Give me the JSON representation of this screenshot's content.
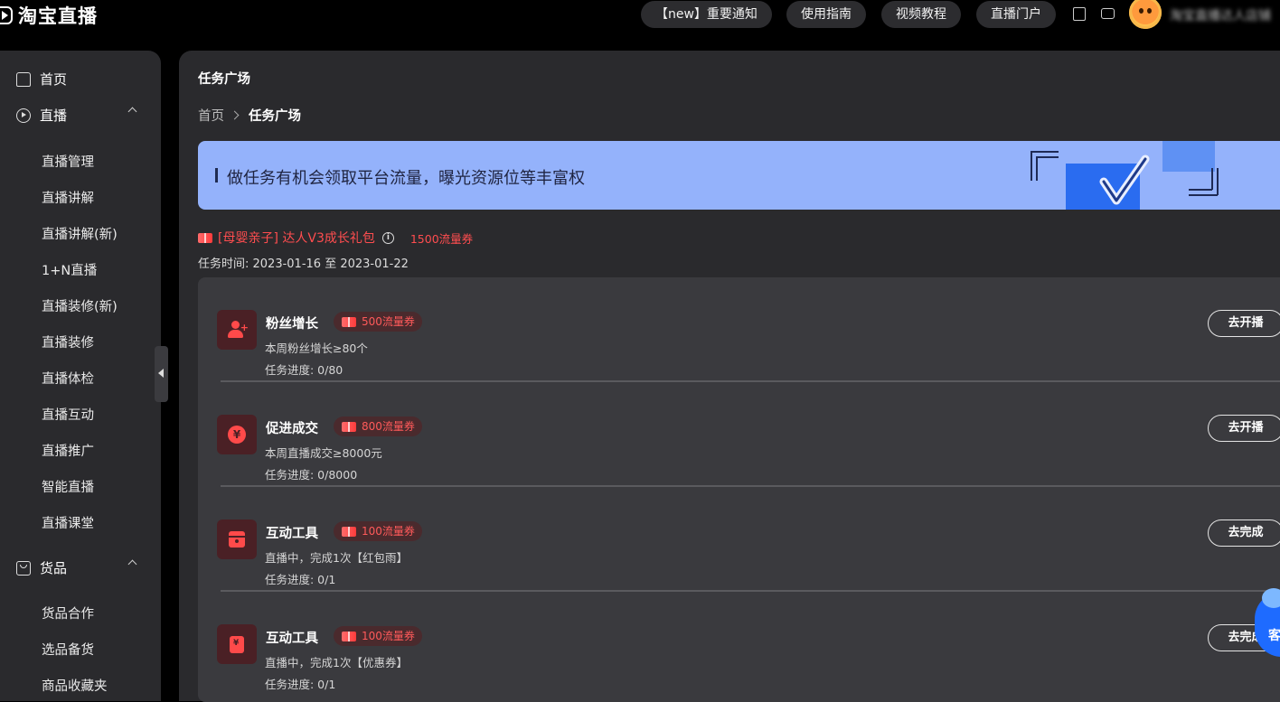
{
  "app": {
    "logo_text": "淘宝直播"
  },
  "topbar": {
    "pills": [
      "【new】重要通知",
      "使用指南",
      "视频教程",
      "直播门户"
    ],
    "username": "淘宝直播达人店铺"
  },
  "sidebar": {
    "groups": [
      {
        "label": "首页"
      },
      {
        "label": "直播",
        "items": [
          "直播管理",
          "直播讲解",
          "直播讲解(新)",
          "1+N直播",
          "直播装修(新)",
          "直播装修",
          "直播体检",
          "直播互动",
          "直播推广",
          "智能直播",
          "直播课堂"
        ]
      },
      {
        "label": "货品",
        "items": [
          "货品合作",
          "选品备货",
          "商品收藏夹"
        ]
      }
    ]
  },
  "main": {
    "page_title": "任务广场",
    "breadcrumb": {
      "home": "首页",
      "current": "任务广场"
    },
    "banner": {
      "text": "做任务有机会领取平台流量，曝光资源位等丰富权"
    },
    "task_package": {
      "name": "[母婴亲子] 达人V3成长礼包",
      "reward": "1500流量券",
      "time": "任务时间: 2023-01-16 至 2023-01-22"
    },
    "tasks": [
      {
        "title": "粉丝增长",
        "badge": "500流量券",
        "desc": "本周粉丝增长≥80个",
        "progress": "任务进度: 0/80",
        "button": "去开播",
        "icon": "user-plus-icon"
      },
      {
        "title": "促进成交",
        "badge": "800流量券",
        "desc": "本周直播成交≥8000元",
        "progress": "任务进度: 0/8000",
        "button": "去开播",
        "icon": "yen-icon"
      },
      {
        "title": "互动工具",
        "badge": "100流量券",
        "desc": "直播中，完成1次【红包雨】",
        "progress": "任务进度: 0/1",
        "button": "去完成",
        "icon": "red-packet-icon"
      },
      {
        "title": "互动工具",
        "badge": "100流量券",
        "desc": "直播中，完成1次【优惠券】",
        "progress": "任务进度: 0/1",
        "button": "去完成",
        "icon": "coupon-bag-icon"
      }
    ]
  },
  "service": {
    "label": "客"
  },
  "colors": {
    "accent_red": "#ff4d4f",
    "banner_bg": "#94b2fb",
    "panel_bg": "#2a2a2d"
  }
}
